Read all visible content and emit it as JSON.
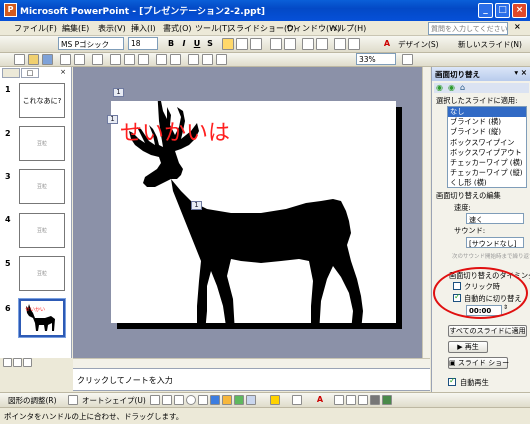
{
  "window": {
    "title": "Microsoft PowerPoint - [プレゼンテーション2-2.ppt]",
    "app_icon": "powerpoint-icon",
    "help_placeholder": "質問を入力してください"
  },
  "menu": [
    "ファイル(F)",
    "編集(E)",
    "表示(V)",
    "挿入(I)",
    "書式(O)",
    "ツール(T)",
    "スライドショー(D)",
    "ウィンドウ(W)",
    "ヘルプ(H)"
  ],
  "toolbar": {
    "font_name": "MS Pゴシック",
    "font_size": "18",
    "bold": "B",
    "italic": "I",
    "underline": "U",
    "shadow": "S",
    "zoom": "33%",
    "design_label": "デザイン(S)",
    "new_slide_label": "新しいスライド(N)"
  },
  "slides_pane": {
    "tabs": [
      "□",
      "×"
    ],
    "slides": [
      {
        "num": "1",
        "text": "これなあに?"
      },
      {
        "num": "2",
        "text": "豆粒"
      },
      {
        "num": "3",
        "text": "豆粒"
      },
      {
        "num": "4",
        "text": "豆粒"
      },
      {
        "num": "5",
        "text": "豆粒"
      },
      {
        "num": "6",
        "text": ""
      }
    ]
  },
  "slide": {
    "text": "せいかいは",
    "markers": [
      "1",
      "1",
      "1"
    ]
  },
  "notes": {
    "placeholder": "クリックしてノートを入力"
  },
  "drawing_toolbar": {
    "draw_label": "図形の調整(R)",
    "autoshapes_label": "オートシェイプ(U)"
  },
  "status": {
    "text": "ポインタをハンドルの上に合わせ、ドラッグします。"
  },
  "taskpane": {
    "title": "画面切り替え",
    "apply_label": "選択したスライドに適用:",
    "effects": [
      "なし",
      "ブラインド (横)",
      "ブラインド (縦)",
      "ボックスワイプイン",
      "ボックスワイプアウト",
      "チェッカーワイプ (横)",
      "チェッカーワイプ (縦)",
      "くし形 (横)"
    ],
    "selected_effect": "なし",
    "edit_label": "画面切り替えの編集",
    "speed_label": "速度:",
    "speed_value": "速く",
    "sound_label": "サウンド:",
    "sound_value": "[サウンドなし]",
    "loop_label": "次のサウンド開始時まで繰り返す",
    "timing_label": "画面切り替えのタイミング",
    "on_click_label": "クリック時",
    "on_click_checked": false,
    "auto_label": "自動的に切り替え",
    "auto_checked": true,
    "auto_time": "00:00",
    "apply_all_label": "すべてのスライドに適用",
    "play_label": "再生",
    "slideshow_label": "スライド ショー",
    "autopreview_label": "自動再生",
    "autopreview_checked": true
  },
  "colors": {
    "title_bar": "#0349c6",
    "slide_text": "#ff2020",
    "annotation_circle": "#e01010",
    "selection": "#316ac5"
  }
}
